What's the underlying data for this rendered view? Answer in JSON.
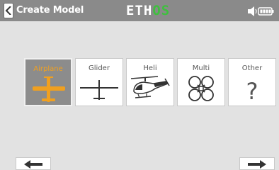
{
  "header": {
    "title": "Create Model",
    "logo_main": "ETH",
    "logo_accent": "OS"
  },
  "model_types": [
    {
      "label": "Airplane",
      "icon": "airplane-icon",
      "selected": true
    },
    {
      "label": "Glider",
      "icon": "glider-icon",
      "selected": false
    },
    {
      "label": "Heli",
      "icon": "helicopter-icon",
      "selected": false
    },
    {
      "label": "Multi",
      "icon": "quadcopter-icon",
      "selected": false
    },
    {
      "label": "Other",
      "icon": "question-mark-icon",
      "selected": false
    }
  ],
  "other_symbol": "?",
  "colors": {
    "titlebar": "#8a8a8a",
    "background": "#e2e2e2",
    "selected_accent": "#f0a020",
    "logo_accent": "#3fbf3f"
  }
}
